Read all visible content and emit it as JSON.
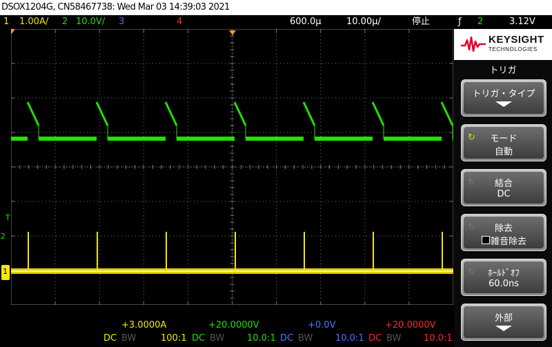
{
  "title": "DSOX1204G, CN58467738: Wed Mar 03 14:39:03 2021",
  "status": {
    "ch1_num": "1",
    "ch1_scale": "1.00A/",
    "ch2_num": "2",
    "ch2_scale": "10.0V/",
    "ch3_num": "3",
    "ch4_num": "4",
    "time_delay": "600.0µ",
    "time_scale": "10.00µ/",
    "run_state": "停止",
    "trig_icon": "ƒ",
    "trig_source": "2",
    "trig_level": "3.12V"
  },
  "bottom": {
    "ch1_offset": "+3.0000A",
    "ch2_offset": "+20.0000V",
    "ch3_offset": "+0.0V",
    "ch4_offset": "+20.0000V",
    "ch1_coupling": "DC",
    "ch1_bw": "BW",
    "ch1_probe": "100:1",
    "ch2_coupling": "DC",
    "ch2_bw": "BW",
    "ch2_probe": "10.0:1",
    "ch3_coupling": "DC",
    "ch3_bw": "BW",
    "ch3_probe": "10.0:1",
    "ch4_coupling": "DC",
    "ch4_bw": "BW",
    "ch4_probe": "10.0:1"
  },
  "markers": {
    "trig_t": "T",
    "ch2_marker": "2",
    "ch1_marker": "1"
  },
  "logo": {
    "name": "KEYSIGHT",
    "sub": "TECHNOLOGIES"
  },
  "menu": {
    "title": "トリガ",
    "trigger_type": "トリガ・タイプ",
    "mode_label": "モード",
    "mode_value": "自動",
    "coupling_label": "結合",
    "coupling_value": "DC",
    "reject_label": "除去",
    "noise_reject": "雑音除去",
    "holdoff_label": "ﾎｰﾙﾄﾞｵﾌ",
    "holdoff_value": "60.0ns",
    "external_label": "外部"
  },
  "colors": {
    "ch1": "#f4e800",
    "ch2": "#22e000",
    "ch3": "#4a78ff",
    "ch4": "#ff2a2a",
    "trigger": "#ff9a1e",
    "grid": "#7a7a7a"
  }
}
